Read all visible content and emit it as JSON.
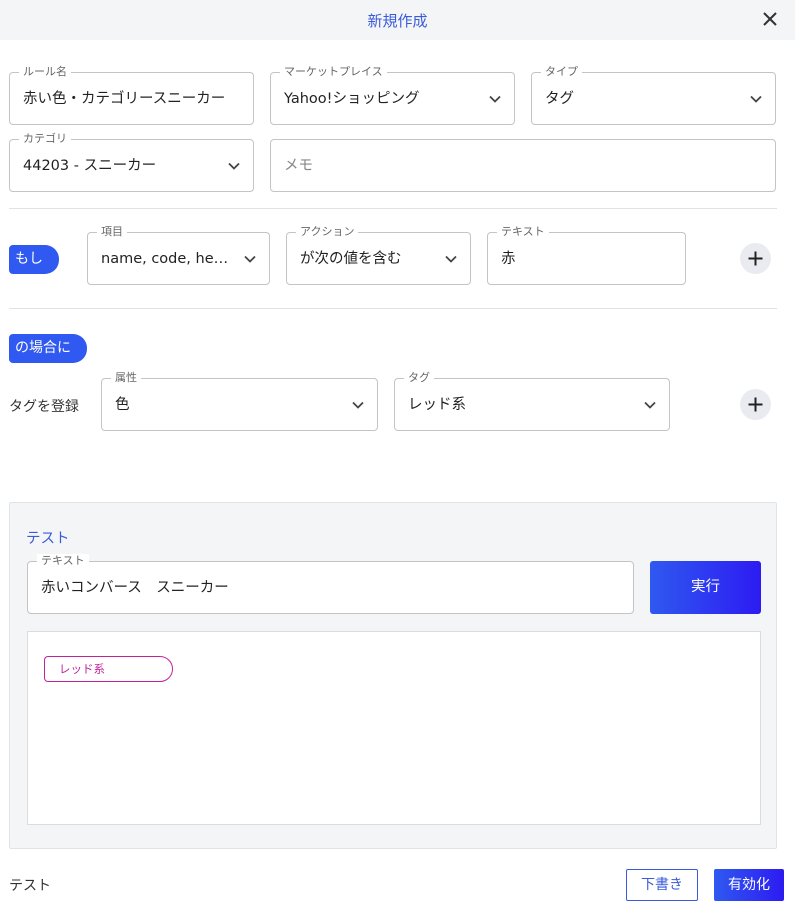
{
  "header": {
    "title": "新規作成",
    "close_icon": "close-icon"
  },
  "rule": {
    "name": {
      "label": "ルール名",
      "value": "赤い色・カテゴリースニーカー"
    },
    "marketplace": {
      "label": "マーケットプレイス",
      "value": "Yahoo!ショッピング"
    },
    "type": {
      "label": "タイプ",
      "value": "タグ"
    },
    "category": {
      "label": "カテゴリ",
      "value": "44203 - スニーカー"
    },
    "memo": {
      "placeholder": "メモ",
      "value": ""
    }
  },
  "condition": {
    "if_label": "もし",
    "item": {
      "label": "項目",
      "value": "name, code, head..."
    },
    "action": {
      "label": "アクション",
      "value": "が次の値を含む"
    },
    "text": {
      "label": "テキスト",
      "value": "赤"
    }
  },
  "consequence": {
    "then_label": "の場合に",
    "action_label": "タグを登録",
    "attribute": {
      "label": "属性",
      "value": "色"
    },
    "tag": {
      "label": "タグ",
      "value": "レッド系"
    }
  },
  "test": {
    "title": "テスト",
    "text": {
      "label": "テキスト",
      "value": "赤いコンバース　スニーカー"
    },
    "run_label": "実行",
    "result_tags": [
      "レッド系"
    ],
    "tag_color": "#c0239c"
  },
  "footer": {
    "label": "テスト",
    "draft_label": "下書き",
    "activate_label": "有効化"
  },
  "colors": {
    "accent": "#2f59f0",
    "accent_dark": "#2d1bf2",
    "title_blue": "#3a5bd9"
  }
}
